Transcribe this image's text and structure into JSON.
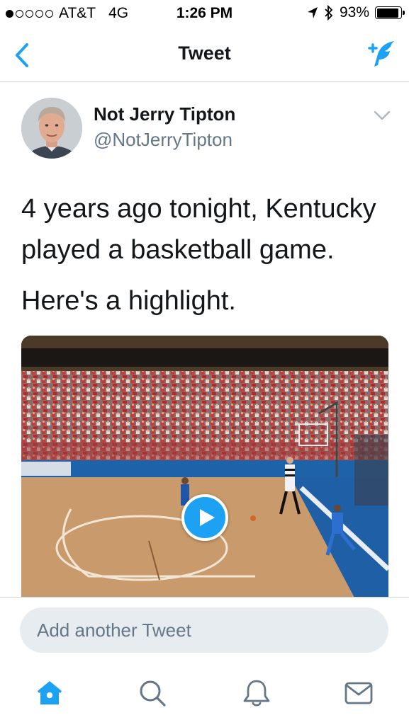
{
  "status_bar": {
    "carrier": "AT&T",
    "network": "4G",
    "time": "1:26 PM",
    "battery": "93%",
    "battery_level": 0.93,
    "signal_bars_filled": 1,
    "signal_bars_total": 5,
    "icons": [
      "location-arrow-icon",
      "bluetooth-icon",
      "battery-icon"
    ]
  },
  "nav": {
    "title": "Tweet",
    "back_icon": "chevron-left-icon",
    "compose_icon": "compose-tweet-icon"
  },
  "tweet": {
    "author_name": "Not Jerry Tipton",
    "author_handle": "@NotJerryTipton",
    "text_line1": "4 years ago tonight, Kentucky played a basketball game.",
    "text_line2": "Here's a highlight.",
    "media_type": "video",
    "media_icon": "play-icon"
  },
  "reply": {
    "placeholder": "Add another Tweet"
  },
  "tab_bar": {
    "items": [
      "home-icon",
      "search-icon",
      "notifications-bell-icon",
      "messages-envelope-icon"
    ],
    "active": "home-icon"
  },
  "colors": {
    "accent": "#1da1f2",
    "text_primary": "#14171a",
    "text_secondary": "#657786",
    "divider": "#cfd6dc",
    "input_bg": "#e6ecf0"
  }
}
